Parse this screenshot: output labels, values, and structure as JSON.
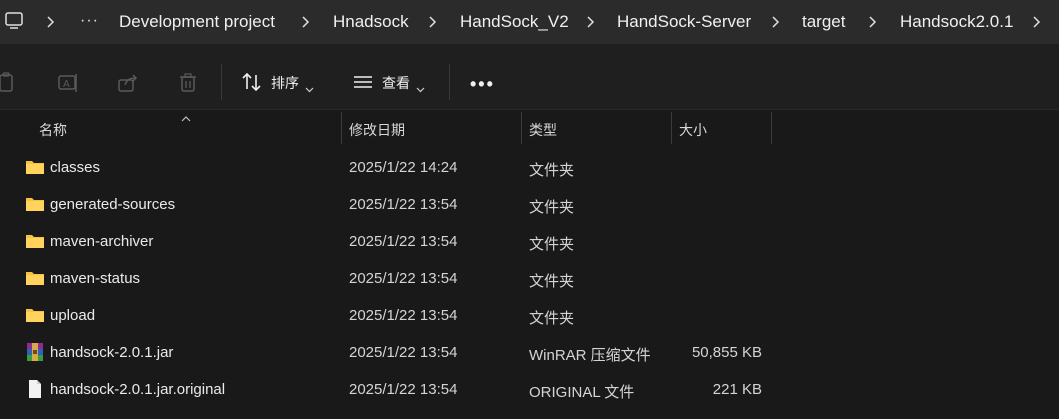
{
  "address_bar": {
    "icon": "computer-icon",
    "overflow": "···",
    "crumbs": [
      "Development project",
      "Hnadsock",
      "HandSock_V2",
      "HandSock-Server",
      "target",
      "Handsock2.0.1"
    ]
  },
  "toolbar": {
    "sort_label": "排序",
    "view_label": "查看",
    "more_label": "•••",
    "icons": [
      "copy-icon",
      "rename-icon",
      "share-icon",
      "delete-icon",
      "sort-icon",
      "view-icon"
    ]
  },
  "columns": {
    "name": "名称",
    "date": "修改日期",
    "type": "类型",
    "size": "大小"
  },
  "files": [
    {
      "name": "classes",
      "date": "2025/1/22 14:24",
      "type": "文件夹",
      "size": "",
      "icon": "folder-icon"
    },
    {
      "name": "generated-sources",
      "date": "2025/1/22 13:54",
      "type": "文件夹",
      "size": "",
      "icon": "folder-icon"
    },
    {
      "name": "maven-archiver",
      "date": "2025/1/22 13:54",
      "type": "文件夹",
      "size": "",
      "icon": "folder-icon"
    },
    {
      "name": "maven-status",
      "date": "2025/1/22 13:54",
      "type": "文件夹",
      "size": "",
      "icon": "folder-icon"
    },
    {
      "name": "upload",
      "date": "2025/1/22 13:54",
      "type": "文件夹",
      "size": "",
      "icon": "folder-icon"
    },
    {
      "name": "handsock-2.0.1.jar",
      "date": "2025/1/22 13:54",
      "type": "WinRAR 压缩文件",
      "size": "50,855 KB",
      "icon": "winrar-archive-icon"
    },
    {
      "name": "handsock-2.0.1.jar.original",
      "date": "2025/1/22 13:54",
      "type": "ORIGINAL 文件",
      "size": "221 KB",
      "icon": "file-icon"
    }
  ],
  "colors": {
    "background": "#191919",
    "address_bar": "#2b2b2b",
    "folder": "#f5c244",
    "text": "#e6e6e6"
  }
}
